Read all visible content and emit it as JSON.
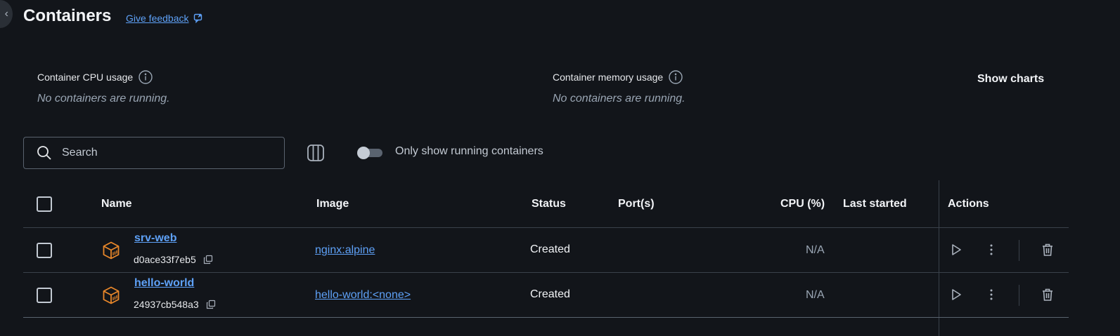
{
  "header": {
    "title": "Containers",
    "feedback_label": "Give feedback"
  },
  "stats": {
    "cpu_label": "Container CPU usage",
    "cpu_empty": "No containers are running.",
    "memory_label": "Container memory usage",
    "memory_empty": "No containers are running.",
    "show_charts_label": "Show charts"
  },
  "toolbar": {
    "search_placeholder": "Search",
    "running_toggle_label": "Only show running containers",
    "running_toggle_on": false
  },
  "table": {
    "columns": {
      "name": "Name",
      "image": "Image",
      "status": "Status",
      "ports": "Port(s)",
      "cpu": "CPU (%)",
      "last_started": "Last started",
      "actions": "Actions"
    },
    "rows": [
      {
        "name": "srv-web",
        "id": "d0ace33f7eb5",
        "image": "nginx:alpine",
        "status": "Created",
        "cpu": "N/A"
      },
      {
        "name": "hello-world",
        "id": "24937cb548a3",
        "image": "hello-world:<none>",
        "status": "Created",
        "cpu": "N/A"
      }
    ]
  },
  "colors": {
    "background": "#12151a",
    "link": "#5ea1f7",
    "container_icon": "#e8872a"
  },
  "icons": {
    "back": "chevron-left-icon",
    "feedback": "feedback-icon",
    "info": "info-icon",
    "search": "search-icon",
    "columns": "columns-icon",
    "container": "container-cube-icon",
    "copy": "copy-icon",
    "start": "play-icon",
    "more": "more-vertical-icon",
    "delete": "trash-icon"
  }
}
